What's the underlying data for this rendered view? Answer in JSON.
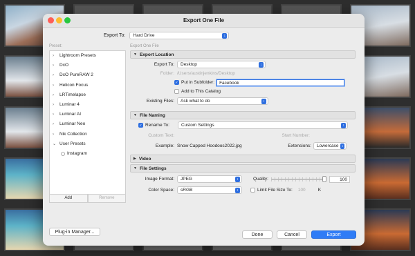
{
  "window": {
    "title": "Export One File"
  },
  "export_to": {
    "label": "Export To:",
    "value": "Hard Drive"
  },
  "presets": {
    "label": "Preset:",
    "items": [
      {
        "label": "Lightroom Presets"
      },
      {
        "label": "DxO"
      },
      {
        "label": "DxO PureRAW 2"
      },
      {
        "label": "Helicon Focus"
      },
      {
        "label": "LRTimelapse"
      },
      {
        "label": "Luminar 4"
      },
      {
        "label": "Luminar AI"
      },
      {
        "label": "Luminar Neo"
      },
      {
        "label": "Nik Collection"
      },
      {
        "label": "User Presets"
      }
    ],
    "sub_items": [
      {
        "label": "Instagram"
      }
    ],
    "add_label": "Add",
    "remove_label": "Remove"
  },
  "right_pane": {
    "label": "Export One File"
  },
  "export_location": {
    "header": "Export Location",
    "export_to_label": "Export To:",
    "export_to_value": "Desktop",
    "folder_label": "Folder:",
    "folder_value": "/Users/austinjenkins/Desktop",
    "put_in_subfolder_label": "Put in Subfolder:",
    "put_in_subfolder_checked": true,
    "subfolder_value": "Facebook",
    "add_to_catalog_label": "Add to This Catalog",
    "add_to_catalog_checked": false,
    "existing_files_label": "Existing Files:",
    "existing_files_value": "Ask what to do"
  },
  "file_naming": {
    "header": "File Naming",
    "rename_to_label": "Rename To:",
    "rename_to_checked": true,
    "rename_to_value": "Custom Settings",
    "custom_text_label": "Custom Text:",
    "start_number_label": "Start Number:",
    "example_label": "Example:",
    "example_value": "Snow Capped Hoodoos2022.jpg",
    "extensions_label": "Extensions:",
    "extensions_value": "Lowercase"
  },
  "video": {
    "header": "Video"
  },
  "file_settings": {
    "header": "File Settings",
    "image_format_label": "Image Format:",
    "image_format_value": "JPEG",
    "quality_label": "Quality:",
    "quality_value": "100",
    "quality_level": 1.0,
    "color_space_label": "Color Space:",
    "color_space_value": "sRGB",
    "limit_size_label": "Limit File Size To:",
    "limit_size_checked": false,
    "limit_size_value": "100",
    "limit_size_unit": "K"
  },
  "footer": {
    "plugin_manager_label": "Plug-in Manager...",
    "done_label": "Done",
    "cancel_label": "Cancel",
    "export_label": "Export"
  },
  "colors": {
    "accent": "#2f7cf6",
    "close": "#fe5f57",
    "minimize": "#febc2e",
    "zoom": "#28c840"
  }
}
